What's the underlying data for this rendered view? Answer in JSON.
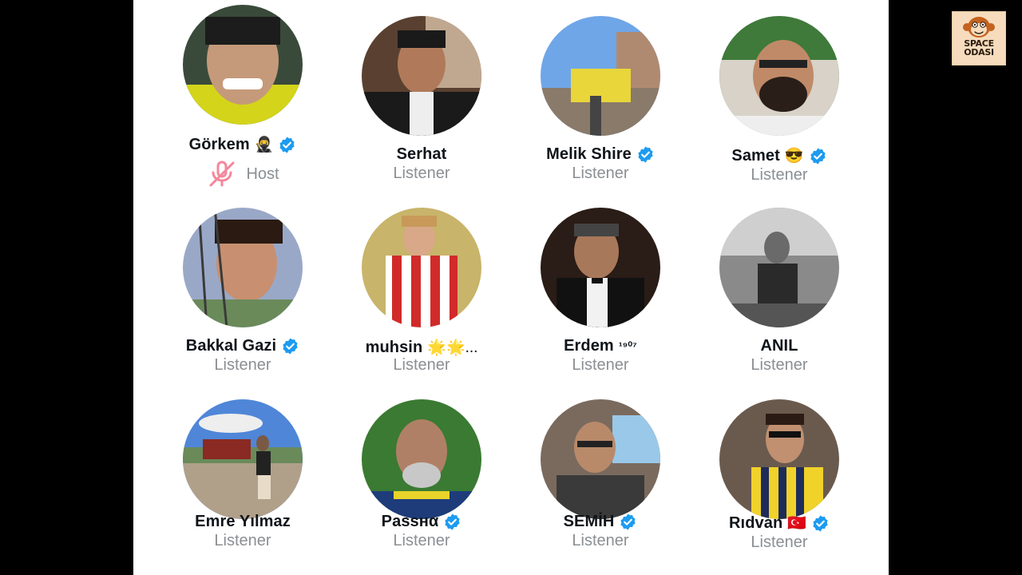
{
  "logo": {
    "line1": "SPACE",
    "line2": "ODASI"
  },
  "participants": [
    {
      "name": "Görkem",
      "emoji": "🥷",
      "verified": true,
      "role": "Host",
      "muted": true
    },
    {
      "name": "Serhat",
      "emoji": "",
      "verified": false,
      "role": "Listener",
      "muted": false
    },
    {
      "name": "Melik Shire",
      "emoji": "",
      "verified": true,
      "role": "Listener",
      "muted": false
    },
    {
      "name": "Samet",
      "emoji": "😎",
      "verified": true,
      "role": "Listener",
      "muted": false
    },
    {
      "name": "Bakkal Gazi",
      "emoji": "",
      "verified": true,
      "role": "Listener",
      "muted": false
    },
    {
      "name": "muhsin",
      "emoji": "🌟🌟...",
      "verified": false,
      "role": "Listener",
      "muted": false
    },
    {
      "name": "Erdem",
      "emoji": "¹⁹⁰⁷",
      "verified": false,
      "role": "Listener",
      "muted": false
    },
    {
      "name": "ANIL",
      "emoji": "",
      "verified": false,
      "role": "Listener",
      "muted": false
    },
    {
      "name": "Emre Yılmaz",
      "emoji": "",
      "verified": false,
      "role": "Listener",
      "muted": false
    },
    {
      "name": "Ρassнα",
      "emoji": "",
      "verified": true,
      "role": "Listener",
      "muted": false
    },
    {
      "name": "SEMİH",
      "emoji": "",
      "verified": true,
      "role": "Listener",
      "muted": false
    },
    {
      "name": "Rıdvan",
      "emoji": "🇹🇷",
      "verified": true,
      "role": "Listener",
      "muted": false
    }
  ],
  "colors": {
    "verified": "#1d9bf0",
    "muted": "#f4879c",
    "name": "#0f1419",
    "role": "#8b8f93"
  }
}
